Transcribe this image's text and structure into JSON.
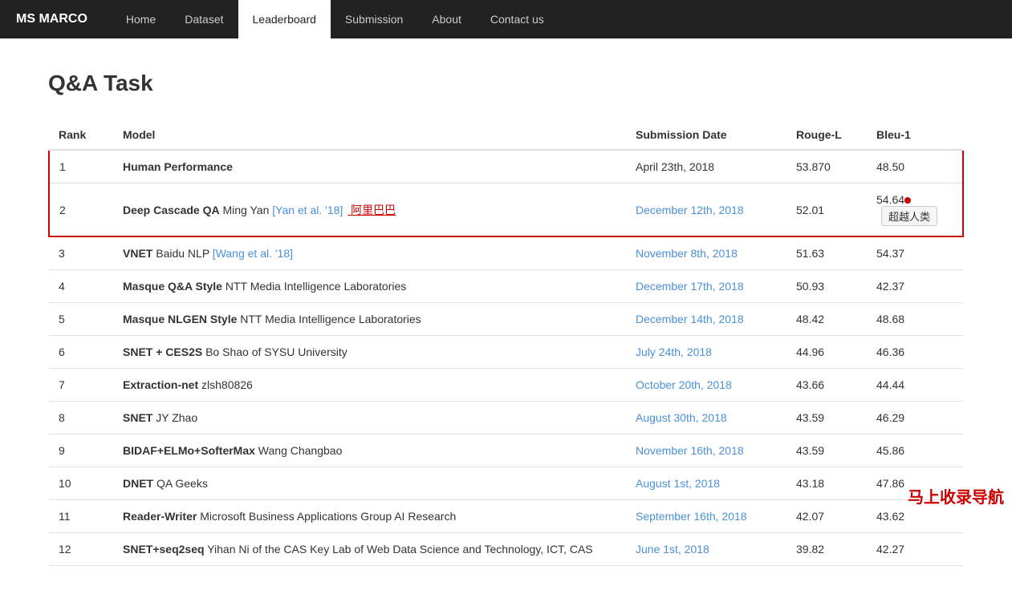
{
  "brand": "MS MARCO",
  "nav": {
    "items": [
      {
        "label": "Home",
        "active": false
      },
      {
        "label": "Dataset",
        "active": false
      },
      {
        "label": "Leaderboard",
        "active": true
      },
      {
        "label": "Submission",
        "active": false
      },
      {
        "label": "About",
        "active": false
      },
      {
        "label": "Contact us",
        "active": false
      }
    ]
  },
  "page": {
    "title": "Q&A Task"
  },
  "table": {
    "columns": {
      "rank": "Rank",
      "model": "Model",
      "date": "Submission Date",
      "rouge": "Rouge-L",
      "bleu": "Bleu-1"
    },
    "rows": [
      {
        "rank": 1,
        "model_bold": "Human Performance",
        "model_extra": "",
        "date": "April 23th, 2018",
        "date_link": false,
        "rouge": "53.870",
        "bleu": "48.50",
        "highlight": true,
        "badge": null,
        "red_dot": false
      },
      {
        "rank": 2,
        "model_bold": "Deep Cascade QA",
        "model_extra": "Ming Yan",
        "model_link1": "[Yan et al. '18]",
        "model_link2": "阿里巴巴",
        "date": "December 12th, 2018",
        "date_link": true,
        "rouge": "52.01",
        "bleu": "54.64",
        "highlight": true,
        "badge": "超越人类",
        "red_dot": true
      },
      {
        "rank": 3,
        "model_bold": "VNET",
        "model_extra": "Baidu NLP",
        "model_link1": "[Wang et al. '18]",
        "model_link2": null,
        "date": "November 8th, 2018",
        "date_link": true,
        "rouge": "51.63",
        "bleu": "54.37",
        "highlight": false,
        "badge": null,
        "red_dot": false
      },
      {
        "rank": 4,
        "model_bold": "Masque Q&A Style",
        "model_extra": "NTT Media Intelligence Laboratories",
        "model_link1": null,
        "model_link2": null,
        "date": "December 17th, 2018",
        "date_link": true,
        "rouge": "50.93",
        "bleu": "42.37",
        "highlight": false,
        "badge": null,
        "red_dot": false
      },
      {
        "rank": 5,
        "model_bold": "Masque NLGEN Style",
        "model_extra": "NTT Media Intelligence Laboratories",
        "model_link1": null,
        "model_link2": null,
        "date": "December 14th, 2018",
        "date_link": true,
        "rouge": "48.42",
        "bleu": "48.68",
        "highlight": false,
        "badge": null,
        "red_dot": false
      },
      {
        "rank": 6,
        "model_bold": "SNET + CES2S",
        "model_extra": "Bo Shao of SYSU University",
        "model_link1": null,
        "model_link2": null,
        "date": "July 24th, 2018",
        "date_link": true,
        "rouge": "44.96",
        "bleu": "46.36",
        "highlight": false,
        "badge": null,
        "red_dot": false
      },
      {
        "rank": 7,
        "model_bold": "Extraction-net",
        "model_extra": "zlsh80826",
        "model_link1": null,
        "model_link2": null,
        "date": "October 20th, 2018",
        "date_link": true,
        "rouge": "43.66",
        "bleu": "44.44",
        "highlight": false,
        "badge": null,
        "red_dot": false
      },
      {
        "rank": 8,
        "model_bold": "SNET",
        "model_extra": "JY Zhao",
        "model_link1": null,
        "model_link2": null,
        "date": "August 30th, 2018",
        "date_link": true,
        "rouge": "43.59",
        "bleu": "46.29",
        "highlight": false,
        "badge": null,
        "red_dot": false
      },
      {
        "rank": 9,
        "model_bold": "BIDAF+ELMo+SofterMax",
        "model_extra": "Wang Changbao",
        "model_link1": null,
        "model_link2": null,
        "date": "November 16th, 2018",
        "date_link": true,
        "rouge": "43.59",
        "bleu": "45.86",
        "highlight": false,
        "badge": null,
        "red_dot": false
      },
      {
        "rank": 10,
        "model_bold": "DNET",
        "model_extra": "QA Geeks",
        "model_link1": null,
        "model_link2": null,
        "date": "August 1st, 2018",
        "date_link": true,
        "rouge": "43.18",
        "bleu": "47.86",
        "highlight": false,
        "badge": null,
        "red_dot": false
      },
      {
        "rank": 11,
        "model_bold": "Reader-Writer",
        "model_extra": "Microsoft Business Applications Group AI Research",
        "model_link1": null,
        "model_link2": null,
        "date": "September 16th, 2018",
        "date_link": true,
        "rouge": "42.07",
        "bleu": "43.62",
        "highlight": false,
        "badge": null,
        "red_dot": false
      },
      {
        "rank": 12,
        "model_bold": "SNET+seq2seq",
        "model_extra": "Yihan Ni of the CAS Key Lab of Web Data Science and Technology, ICT, CAS",
        "model_link1": null,
        "model_link2": null,
        "date": "June 1st, 2018",
        "date_link": true,
        "rouge": "39.82",
        "bleu": "42.27",
        "highlight": false,
        "badge": null,
        "red_dot": false
      }
    ]
  },
  "watermark": "马上收录导航"
}
